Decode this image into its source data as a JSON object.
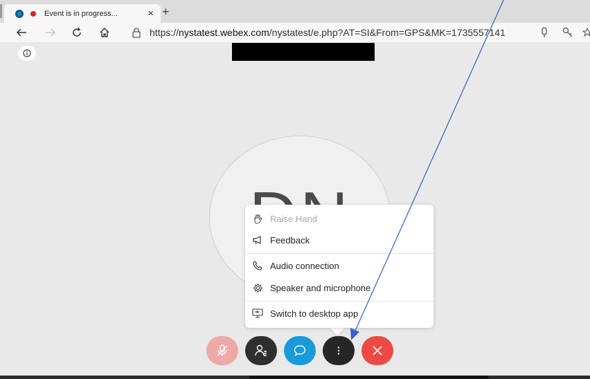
{
  "browser": {
    "tab_title": "Event is in progress...",
    "tab_close": "×",
    "new_tab": "+",
    "url_prefix": "https://",
    "url_host": "nystatest.webex.com",
    "url_path": "/nystatest/e.php?AT=SI&From=GPS&MK=1735557141"
  },
  "avatar": {
    "initials": "DN"
  },
  "more_menu": {
    "items": [
      {
        "label": "Raise Hand",
        "icon": "raise-hand-icon",
        "disabled": true
      },
      {
        "label": "Feedback",
        "icon": "megaphone-icon",
        "disabled": false
      },
      {
        "label": "Audio connection",
        "icon": "phone-icon",
        "disabled": false
      },
      {
        "label": "Speaker and microphone",
        "icon": "gear-icon",
        "disabled": false
      },
      {
        "label": "Switch to desktop app",
        "icon": "desktop-app-icon",
        "disabled": false
      }
    ]
  },
  "controls": [
    {
      "name": "mute",
      "icon": "mic-muted-icon",
      "color": "#eea9a6"
    },
    {
      "name": "participants",
      "icon": "participants-icon",
      "color": "#2f2f2f"
    },
    {
      "name": "chat",
      "icon": "chat-icon",
      "color": "#1b9ad9"
    },
    {
      "name": "more",
      "icon": "more-vertical-icon",
      "color": "#262626"
    },
    {
      "name": "leave",
      "icon": "close-icon",
      "color": "#ee4a45"
    }
  ],
  "colors": {
    "annotation_arrow": "#2f5fc4",
    "page_background": "#e9e9e9"
  }
}
